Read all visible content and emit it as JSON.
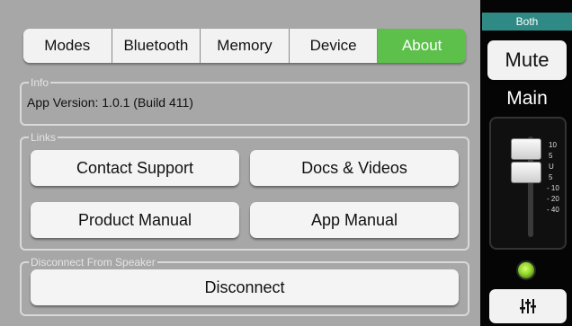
{
  "tabs": [
    {
      "label": "Modes",
      "active": false
    },
    {
      "label": "Bluetooth",
      "active": false
    },
    {
      "label": "Memory",
      "active": false
    },
    {
      "label": "Device",
      "active": false
    },
    {
      "label": "About",
      "active": true
    }
  ],
  "info": {
    "legend": "Info",
    "app_version": "App Version:  1.0.1 (Build 411)"
  },
  "links": {
    "legend": "Links",
    "contact_support": "Contact Support",
    "docs_videos": "Docs & Videos",
    "product_manual": "Product Manual",
    "app_manual": "App Manual"
  },
  "disconnect": {
    "legend": "Disconnect From Speaker",
    "button": "Disconnect"
  },
  "side": {
    "mode": "Both",
    "mute": "Mute",
    "channel": "Main",
    "scale": [
      "10",
      "5",
      "U",
      "5",
      "- 10",
      "- 20",
      "- 40"
    ],
    "led_color": "#8fd52b",
    "mixer_icon": "mixer-sliders-icon"
  },
  "colors": {
    "accent": "#5cc04b",
    "mode_bar": "#2f8a86",
    "panel_bg": "#a7a7a7"
  }
}
